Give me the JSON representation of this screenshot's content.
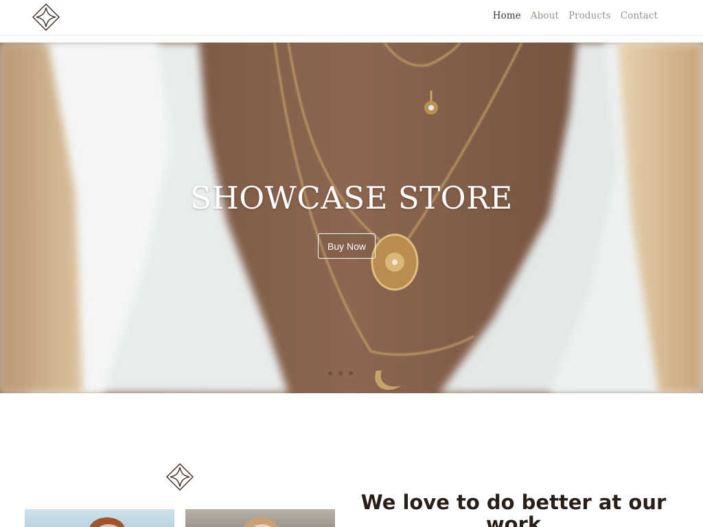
{
  "header": {
    "logo_icon": "diamond-logo-icon",
    "nav": [
      {
        "label": "Home",
        "active": true
      },
      {
        "label": "About",
        "active": false
      },
      {
        "label": "Products",
        "active": false
      },
      {
        "label": "Contact",
        "active": false
      }
    ]
  },
  "hero": {
    "title": "SHOWCASE STORE",
    "button_label": "Buy Now",
    "image": "woman-wearing-layered-gold-necklaces",
    "slide_count": 3
  },
  "about": {
    "logo_icon": "diamond-logo-icon",
    "headline": "We love to do better at our work",
    "images": [
      "woman-portrait-blue-sky",
      "woman-portrait-neutral-background"
    ]
  },
  "colors": {
    "text_dark": "#2a1e18",
    "nav_inactive": "#9a948e",
    "nav_active": "#3a3430",
    "skin": "#8a6a55",
    "gold": "#c9a46a"
  }
}
